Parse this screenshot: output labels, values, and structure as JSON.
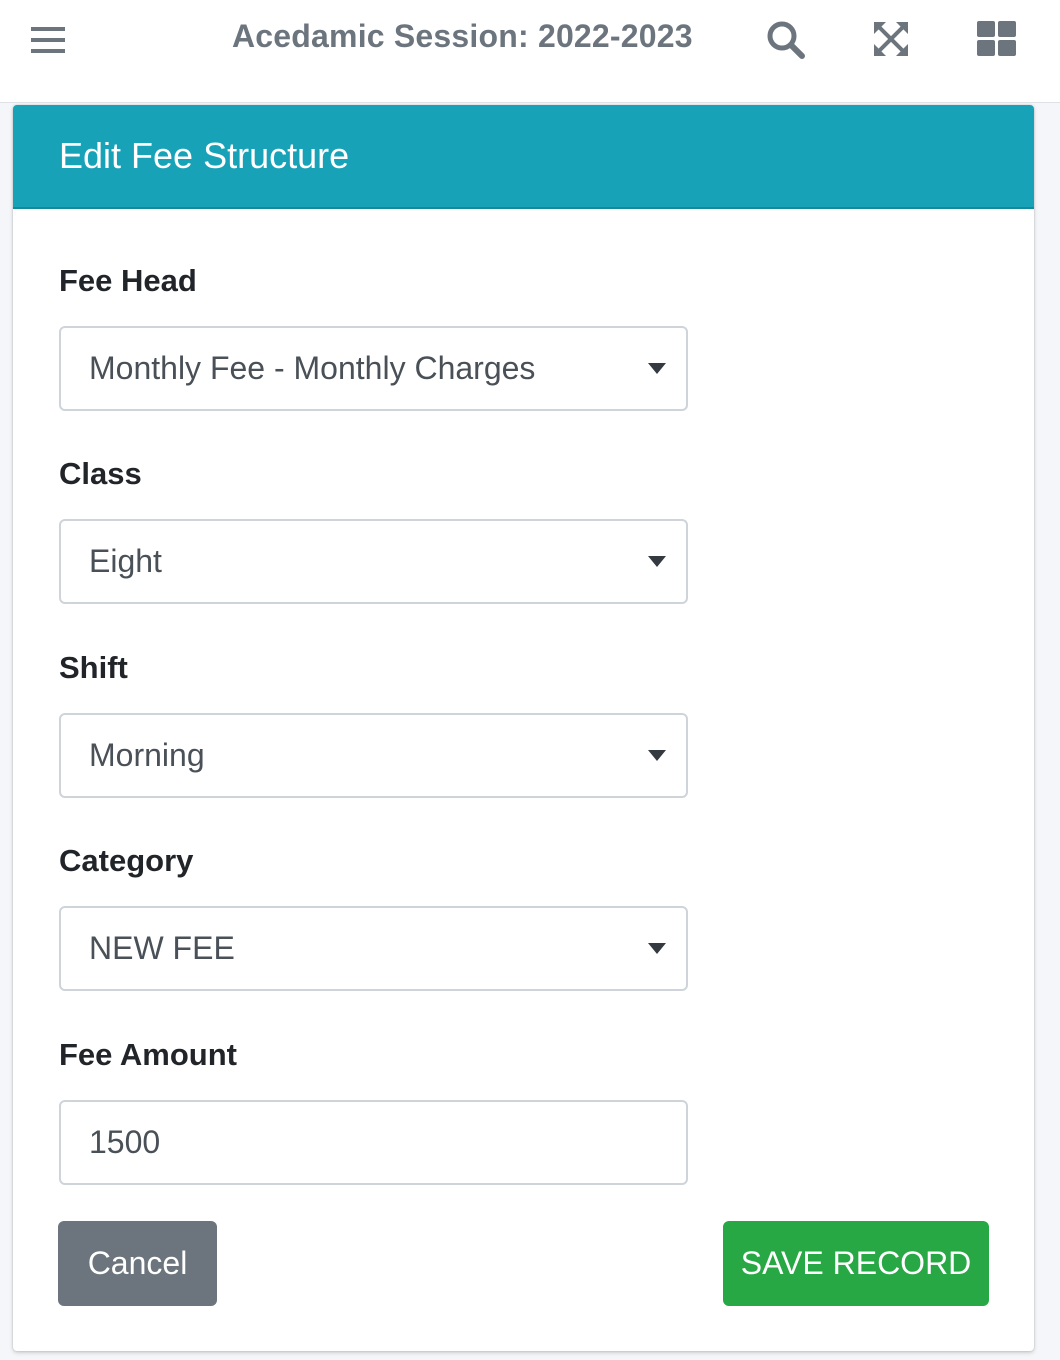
{
  "header": {
    "session_title": "Acedamic Session: 2022-2023",
    "icons": [
      "hamburger-menu-icon",
      "search-icon",
      "fullscreen-icon",
      "grid-apps-icon"
    ]
  },
  "card": {
    "title": "Edit Fee Structure",
    "header_color": "#17a2b8"
  },
  "form": {
    "fee_head": {
      "label": "Fee Head",
      "value": "Monthly Fee - Monthly Charges"
    },
    "class": {
      "label": "Class",
      "value": "Eight"
    },
    "shift": {
      "label": "Shift",
      "value": "Morning"
    },
    "category": {
      "label": "Category",
      "value": "NEW FEE"
    },
    "fee_amount": {
      "label": "Fee Amount",
      "value": "1500"
    }
  },
  "actions": {
    "cancel_label": "Cancel",
    "cancel_color": "#6c757d",
    "save_label": "SAVE RECORD",
    "save_color": "#28a745"
  }
}
